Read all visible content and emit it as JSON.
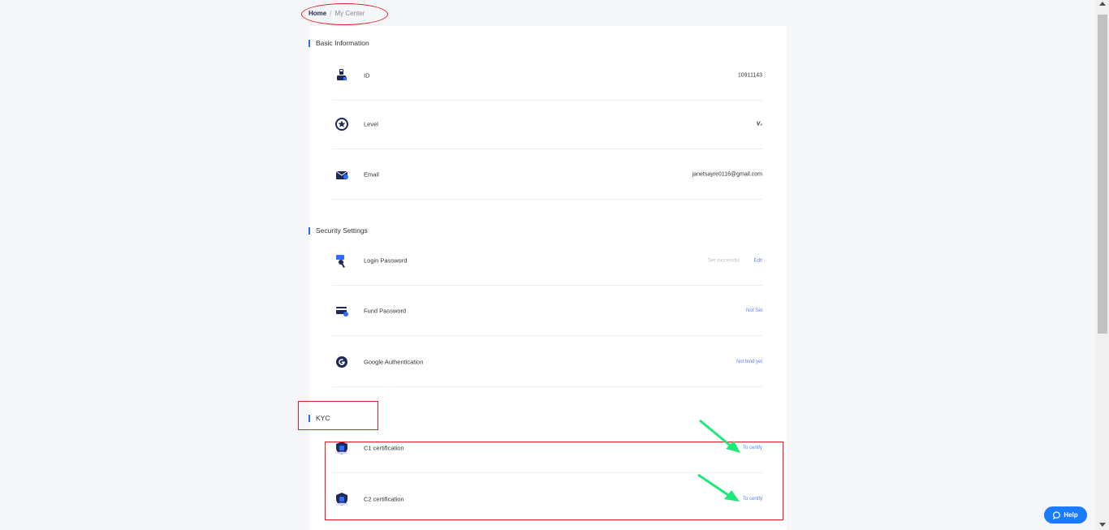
{
  "breadcrumb": {
    "home": "Home",
    "separator": "/",
    "current": "My Center"
  },
  "sections": {
    "basic": {
      "title": "Basic Information"
    },
    "security": {
      "title": "Security Settings"
    },
    "kyc": {
      "title": "KYC"
    }
  },
  "basic_rows": {
    "id": {
      "label": "ID",
      "value": "10911143",
      "icon": "user-id-icon"
    },
    "level": {
      "label": "Level",
      "value": "V₀",
      "icon": "star-badge-icon"
    },
    "email": {
      "label": "Email",
      "value": "janetsayre0116@gmail.com",
      "icon": "mail-icon"
    }
  },
  "security_rows": {
    "login": {
      "label": "Login Password",
      "status": "Set successful",
      "action": "Edit",
      "icon": "key-icon"
    },
    "fund": {
      "label": "Fund Password",
      "action": "Not Set",
      "icon": "card-icon"
    },
    "google": {
      "label": "Google Authentication",
      "action": "Not bind yet",
      "icon": "google-icon"
    }
  },
  "kyc_rows": {
    "c1": {
      "label": "C1 certification",
      "action": "To certify",
      "icon": "certificate-icon"
    },
    "c2": {
      "label": "C2 certification",
      "action": "To certify",
      "icon": "certificate-icon"
    }
  },
  "help": {
    "label": "Help"
  },
  "colors": {
    "accent": "#2f6bff",
    "link": "#5b7fff",
    "annotation": "#e02020",
    "arrow": "#1ee87a"
  }
}
